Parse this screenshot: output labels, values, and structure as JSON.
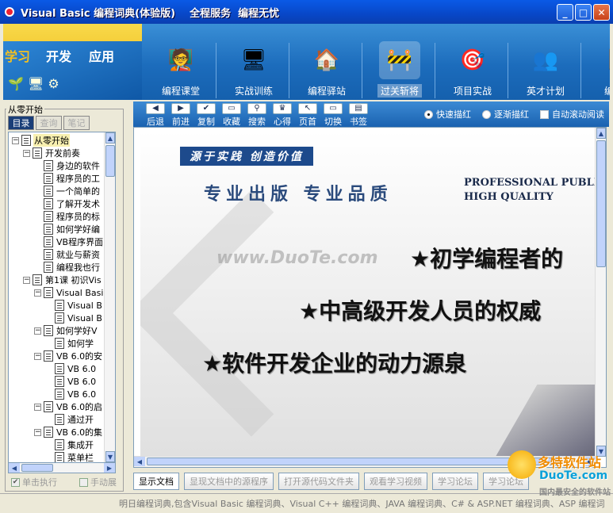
{
  "window": {
    "title": "Visual Basic 编程词典(体验版)    全程服务  编程无忧",
    "btn_min": "_",
    "btn_max": "□",
    "btn_close": "✕"
  },
  "header": {
    "tabs": [
      "学习",
      "开发",
      "应用"
    ],
    "nav": [
      {
        "label": "编程课堂",
        "icon": "🧑‍🏫"
      },
      {
        "label": "实战训练",
        "icon": "🖥"
      },
      {
        "label": "编程驿站",
        "icon": "🏠"
      },
      {
        "label": "过关斩将",
        "icon": "🚧"
      },
      {
        "label": "项目实战",
        "icon": "🎯"
      },
      {
        "label": "英才计划",
        "icon": "👥"
      },
      {
        "label": "编程规",
        "icon": "📘"
      }
    ]
  },
  "left": {
    "group": "从零开始",
    "tabs": [
      "目录",
      "查询",
      "笔记"
    ],
    "tree": [
      {
        "text": "从零开始",
        "level": 0,
        "exp": "−",
        "sel": true
      },
      {
        "text": "开发前奏",
        "level": 1,
        "exp": "−"
      },
      {
        "text": "身边的软件",
        "level": 2
      },
      {
        "text": "程序员的工",
        "level": 2
      },
      {
        "text": "一个简单的",
        "level": 2
      },
      {
        "text": "了解开发术",
        "level": 2
      },
      {
        "text": "程序员的标",
        "level": 2
      },
      {
        "text": "如何学好编",
        "level": 2
      },
      {
        "text": "VB程序界面",
        "level": 2
      },
      {
        "text": "就业与薪资",
        "level": 2
      },
      {
        "text": "编程我也行",
        "level": 2
      },
      {
        "text": "第1课  初识Vis",
        "level": 1,
        "exp": "−"
      },
      {
        "text": "Visual Basic",
        "level": 2,
        "exp": "−"
      },
      {
        "text": "Visual B",
        "level": 3
      },
      {
        "text": "Visual B",
        "level": 3
      },
      {
        "text": "如何学好V",
        "level": 2,
        "exp": "−"
      },
      {
        "text": "如何学",
        "level": 3
      },
      {
        "text": "VB 6.0的安",
        "level": 2,
        "exp": "−"
      },
      {
        "text": "VB 6.0",
        "level": 3
      },
      {
        "text": "VB 6.0",
        "level": 3
      },
      {
        "text": "VB 6.0",
        "level": 3
      },
      {
        "text": "VB 6.0的启",
        "level": 2,
        "exp": "−"
      },
      {
        "text": "通过开",
        "level": 3
      },
      {
        "text": "VB 6.0的集",
        "level": 2,
        "exp": "−"
      },
      {
        "text": "集成开",
        "level": 3
      },
      {
        "text": "菜单栏",
        "level": 3
      }
    ],
    "check1": "单击执行",
    "check2": "手动展"
  },
  "toolbar": {
    "buttons": [
      {
        "label": "后退",
        "icon": "◀"
      },
      {
        "label": "前进",
        "icon": "▶"
      },
      {
        "label": "复制",
        "icon": "✔"
      },
      {
        "label": "收藏",
        "icon": "▭"
      },
      {
        "label": "搜索",
        "icon": "⚲"
      },
      {
        "label": "心得",
        "icon": "♛"
      },
      {
        "label": "页首",
        "icon": "↖"
      },
      {
        "label": "切换",
        "icon": "▭"
      },
      {
        "label": "书签",
        "icon": "▤"
      }
    ],
    "opt1": "快速描红",
    "opt2": "逐渐描红",
    "opt3": "自动滚动阅读"
  },
  "banner": {
    "slogan": "源于实践  创造价值",
    "pro": "专业出版  专业品质",
    "eng1": "PROFESSIONAL PUBLIS",
    "eng2": "HIGH QUALITY",
    "watermark": "www.DuoTe.com",
    "line1": "★初学编程者的",
    "line2": "★中高级开发人员的权威",
    "line3": "★软件开发企业的动力源泉"
  },
  "bottom_tabs": [
    "显示文档",
    "显现文档中的源程序",
    "打开源代码文件夹",
    "观看学习视频",
    "学习论坛",
    "学习论坛"
  ],
  "status": "明日编程词典,包含Visual Basic 编程词典、Visual C++ 编程词典、JAVA 编程词典、C# & ASP.NET 编程词典、ASP 编程词",
  "logo": {
    "cn": "多特软件站",
    "en": "DuoTe.com",
    "sub": "国内最安全的软件站"
  }
}
